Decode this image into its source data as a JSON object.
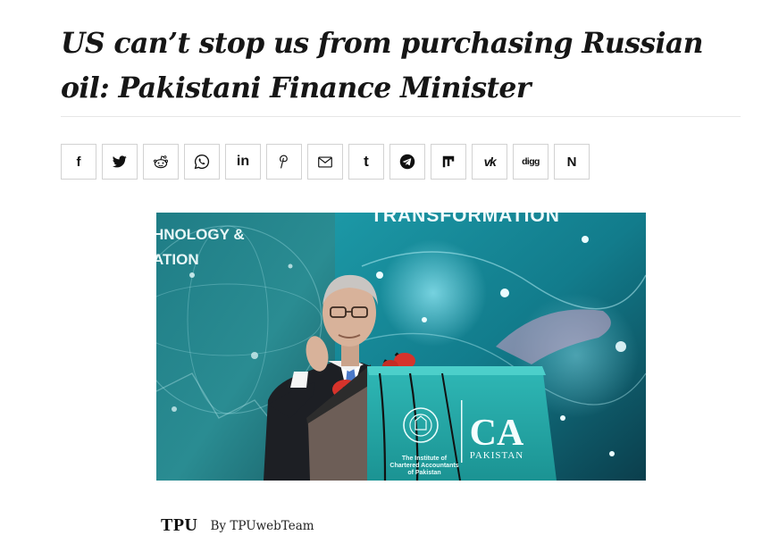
{
  "article": {
    "title": "US can’t stop us from purchasing Russian oil: Pakistani Finance Minister"
  },
  "share_buttons": [
    {
      "network": "facebook",
      "icon": "facebook-icon",
      "glyph": "f"
    },
    {
      "network": "twitter",
      "icon": "twitter-icon"
    },
    {
      "network": "reddit",
      "icon": "reddit-icon"
    },
    {
      "network": "whatsapp",
      "icon": "whatsapp-icon"
    },
    {
      "network": "linkedin",
      "icon": "linkedin-icon",
      "glyph": "in"
    },
    {
      "network": "pinterest",
      "icon": "pinterest-icon",
      "glyph": "𝓅"
    },
    {
      "network": "email",
      "icon": "email-icon"
    },
    {
      "network": "tumblr",
      "icon": "tumblr-icon",
      "glyph": "t"
    },
    {
      "network": "telegram",
      "icon": "telegram-icon"
    },
    {
      "network": "mix",
      "icon": "mix-icon"
    },
    {
      "network": "vk",
      "icon": "vk-icon",
      "glyph": "vk"
    },
    {
      "network": "digg",
      "icon": "digg-icon",
      "glyph": "digg"
    },
    {
      "network": "newsvine",
      "icon": "newsvine-icon",
      "glyph": "N"
    }
  ],
  "hero": {
    "backdrop_left_text_1": "HNOLOGY &",
    "backdrop_left_text_2": "ATION",
    "backdrop_right_text": "TRANSFORMATION",
    "podium_logo": "CA",
    "podium_logo_sub": "PAKISTAN",
    "podium_text_1": "The Institute of",
    "podium_text_2": "Chartered Accountants",
    "podium_text_3": "of Pakistan"
  },
  "byline": {
    "logo": "TPU",
    "by": "By",
    "author": "TPUwebTeam"
  },
  "colors": {
    "rule": "#e6e6e6",
    "button_border": "#d2d2d2",
    "backdrop_teal": "#1f8c98",
    "podium_teal": "#1fa5a4"
  }
}
